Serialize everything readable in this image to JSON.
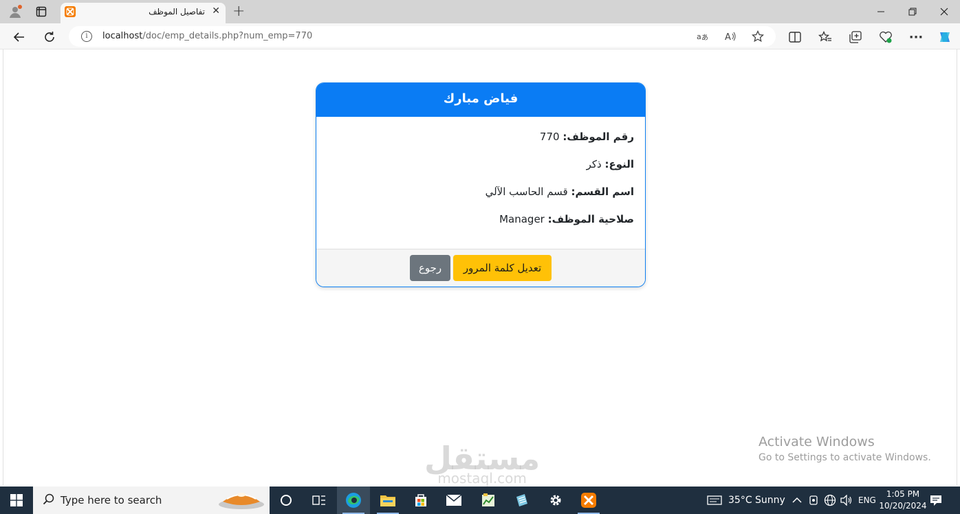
{
  "browser": {
    "tab_title": "تفاصيل الموظف",
    "url_host": "localhost",
    "url_path": "/doc/emp_details.php?num_emp=770"
  },
  "card": {
    "header": "فياض مبارك",
    "rows": [
      {
        "label": "رقم الموظف:",
        "value": "770"
      },
      {
        "label": "النوع:",
        "value": "ذكر"
      },
      {
        "label": "اسم القسم:",
        "value": "قسم الحاسب الآلي"
      },
      {
        "label": "صلاحية الموظف:",
        "value": "Manager"
      }
    ],
    "edit_password_label": "تعديل كلمة المرور",
    "back_label": "رجوع"
  },
  "activate": {
    "title": "Activate Windows",
    "subtitle": "Go to Settings to activate Windows."
  },
  "watermark": {
    "arabic": "مستقل",
    "latin": "mostaql.com"
  },
  "taskbar": {
    "search_placeholder": "Type here to search",
    "weather": "35°C  Sunny",
    "language": "ENG",
    "time": "1:05 PM",
    "date": "10/20/2024"
  },
  "colors": {
    "primary": "#0a7cf4",
    "warning": "#ffc107",
    "secondary": "#6c757d"
  }
}
